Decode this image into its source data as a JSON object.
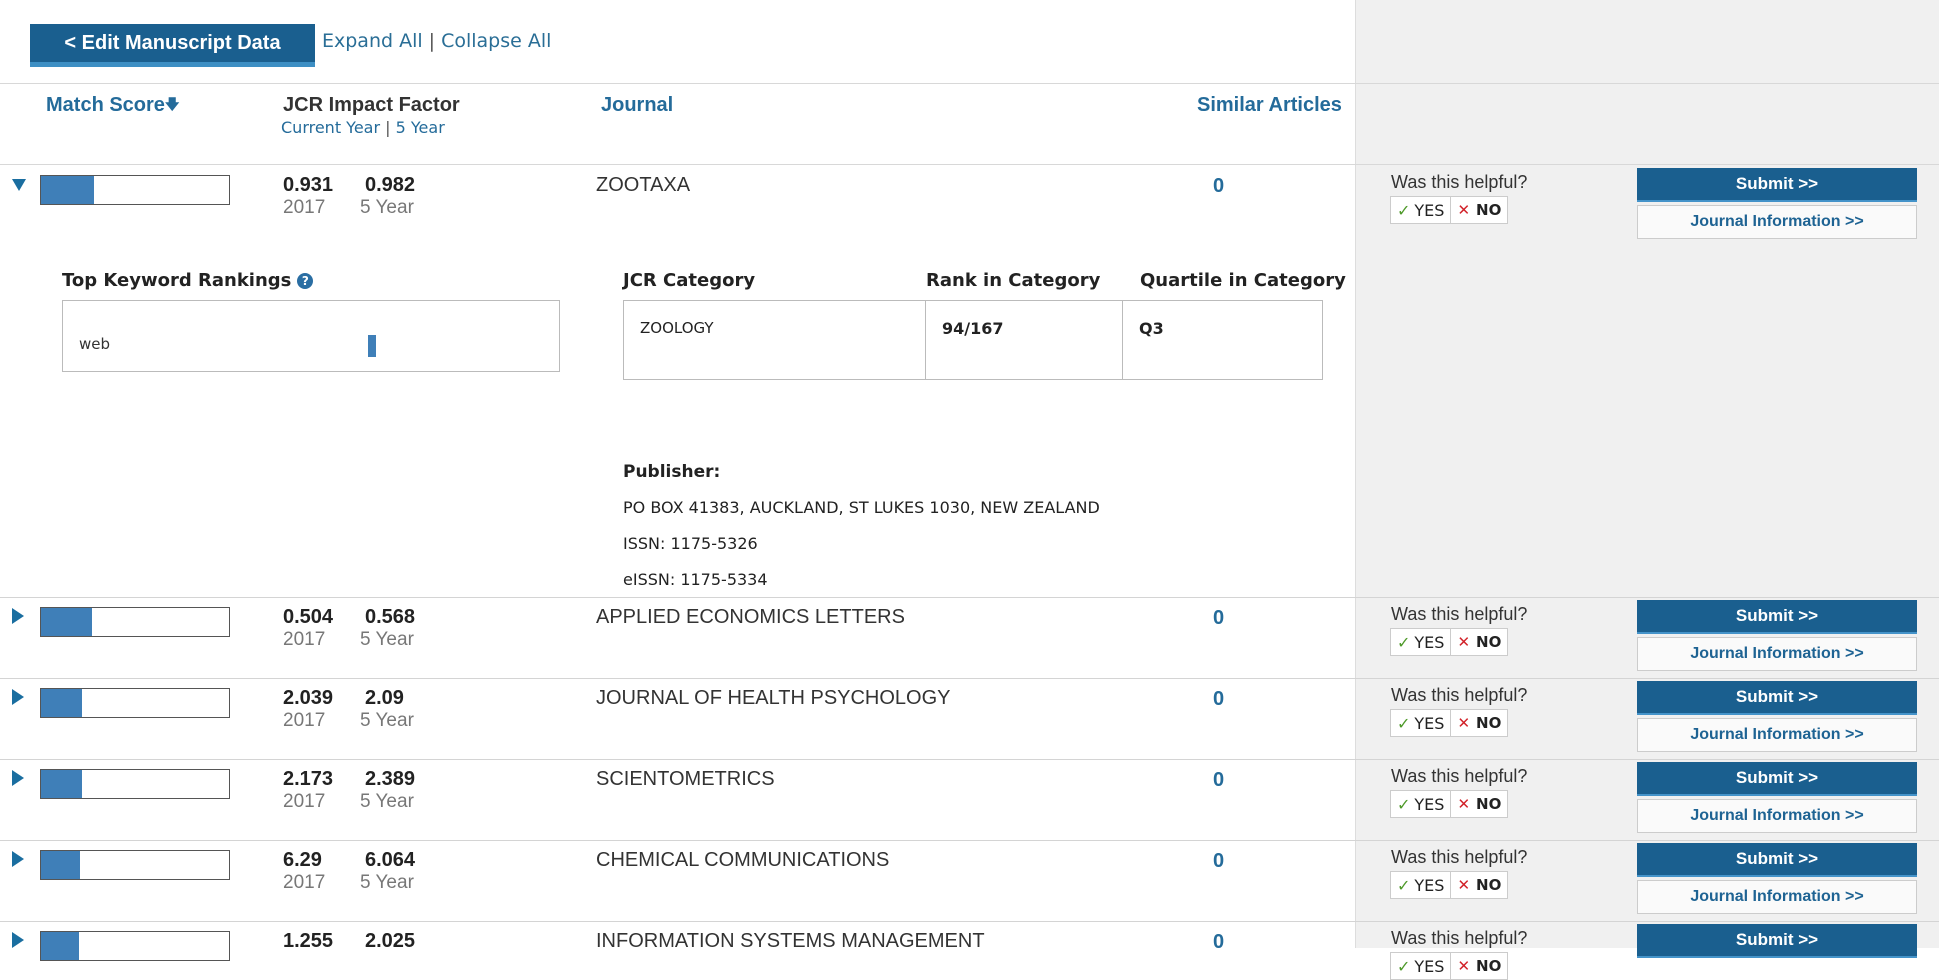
{
  "header": {
    "edit_button": "< Edit Manuscript Data",
    "expand_all": "Expand All",
    "separator": "|",
    "collapse_all": "Collapse All"
  },
  "columns": {
    "match_score": "Match Score",
    "sort_icon": "arrow-down-icon",
    "jcr_impact_factor": "JCR Impact Factor",
    "current_year": "Current Year",
    "sep": "|",
    "five_year": "5 Year",
    "journal": "Journal",
    "similar_articles": "Similar Articles"
  },
  "feedback": {
    "question": "Was this helpful?",
    "yes": "YES",
    "no": "NO",
    "submit": "Submit >>",
    "journal_info": "Journal Information >>"
  },
  "expanded": {
    "top_keyword_rankings": "Top Keyword Rankings",
    "help_icon": "?",
    "keyword": "web",
    "jcr_category_h": "JCR Category",
    "rank_h": "Rank in Category",
    "quartile_h": "Quartile in Category",
    "category": "ZOOLOGY",
    "rank": "94/167",
    "quartile": "Q3",
    "publisher_label": "Publisher:",
    "publisher_address": "PO BOX 41383, AUCKLAND, ST LUKES 1030, NEW ZEALAND",
    "issn": "ISSN: 1175-5326",
    "eissn": "eISSN: 1175-5334"
  },
  "rows": [
    {
      "if_current": "0.931",
      "if_5yr": "0.982",
      "year": "2017",
      "five_year_label": "5 Year",
      "journal": "ZOOTAXA",
      "similar": "0",
      "match_fraction": 0.28,
      "expanded": true
    },
    {
      "if_current": "0.504",
      "if_5yr": "0.568",
      "year": "2017",
      "five_year_label": "5 Year",
      "journal": "APPLIED ECONOMICS LETTERS",
      "similar": "0",
      "match_fraction": 0.27,
      "expanded": false
    },
    {
      "if_current": "2.039",
      "if_5yr": "2.09",
      "year": "2017",
      "five_year_label": "5 Year",
      "journal": "JOURNAL OF HEALTH PSYCHOLOGY",
      "similar": "0",
      "match_fraction": 0.22,
      "expanded": false
    },
    {
      "if_current": "2.173",
      "if_5yr": "2.389",
      "year": "2017",
      "five_year_label": "5 Year",
      "journal": "SCIENTOMETRICS",
      "similar": "0",
      "match_fraction": 0.22,
      "expanded": false
    },
    {
      "if_current": "6.29",
      "if_5yr": "6.064",
      "year": "2017",
      "five_year_label": "5 Year",
      "journal": "CHEMICAL COMMUNICATIONS",
      "similar": "0",
      "match_fraction": 0.21,
      "expanded": false
    },
    {
      "if_current": "1.255",
      "if_5yr": "2.025",
      "year": "",
      "five_year_label": "",
      "journal": "INFORMATION SYSTEMS MANAGEMENT",
      "similar": "0",
      "match_fraction": 0.2,
      "expanded": false
    }
  ]
}
